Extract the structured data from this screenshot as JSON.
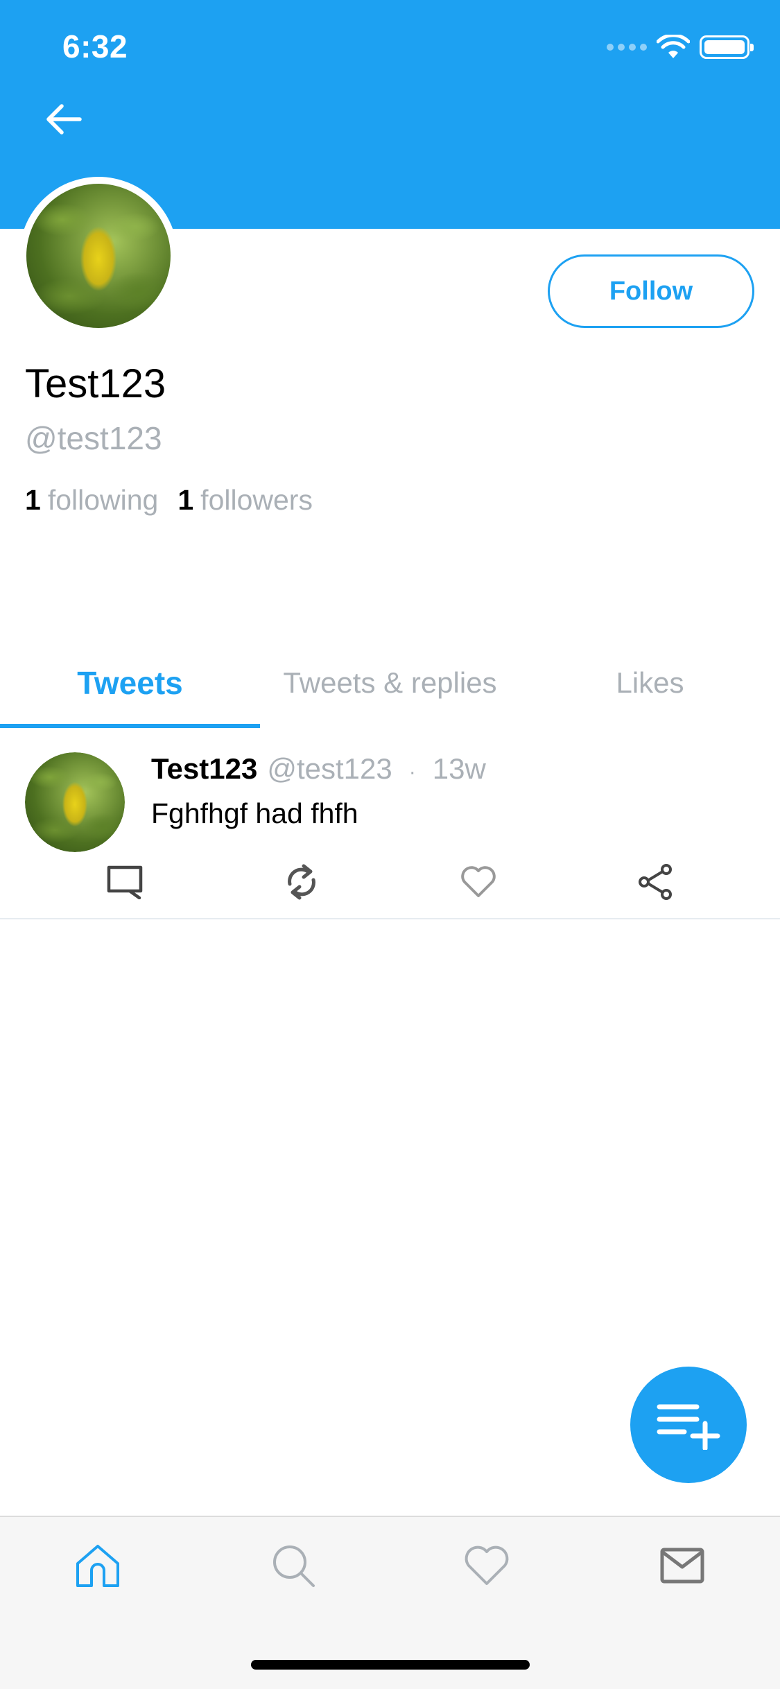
{
  "status_bar": {
    "time": "6:32"
  },
  "profile": {
    "name": "Test123",
    "handle": "@test123",
    "following_count": "1",
    "following_label": "following",
    "followers_count": "1",
    "followers_label": "followers",
    "follow_button": "Follow"
  },
  "tabs": [
    {
      "label": "Tweets",
      "active": true
    },
    {
      "label": "Tweets & replies",
      "active": false
    },
    {
      "label": "Likes",
      "active": false
    }
  ],
  "tweets": [
    {
      "name": "Test123",
      "handle": "@test123",
      "separator": "·",
      "time": "13w",
      "text": "Fghfhgf had fhfh"
    }
  ],
  "icons": {
    "back": "back-arrow-icon",
    "reply": "reply-icon",
    "retweet": "retweet-icon",
    "like": "heart-icon",
    "share": "share-icon",
    "compose": "compose-list-plus-icon",
    "home": "home-icon",
    "search": "search-icon",
    "notifications": "heart-icon",
    "messages": "mail-icon"
  },
  "colors": {
    "accent": "#1da1f2",
    "muted_text": "#aab0b6",
    "tabbar_bg": "#f6f6f6"
  }
}
